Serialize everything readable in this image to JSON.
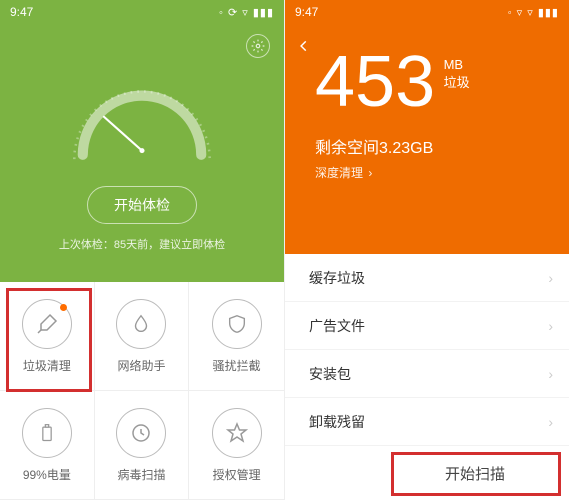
{
  "status": {
    "time": "9:47"
  },
  "left": {
    "start_button": "开始体检",
    "last_check": "上次体检：85天前，建议立即体检",
    "tiles": [
      {
        "label": "垃圾清理"
      },
      {
        "label": "网络助手"
      },
      {
        "label": "骚扰拦截"
      },
      {
        "label": "99%电量"
      },
      {
        "label": "病毒扫描"
      },
      {
        "label": "授权管理"
      }
    ]
  },
  "right": {
    "number": "453",
    "unit": "MB",
    "unit_sub": "垃圾",
    "remaining": "剩余空间3.23GB",
    "deep_clean": "深度清理",
    "rows": [
      "缓存垃圾",
      "广告文件",
      "安装包",
      "卸载残留"
    ],
    "scan_button": "开始扫描"
  }
}
